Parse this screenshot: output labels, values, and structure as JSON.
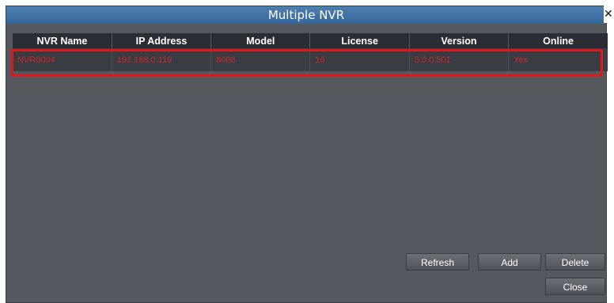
{
  "window": {
    "title": "Multiple NVR",
    "close_glyph": "✕"
  },
  "table": {
    "headers": [
      "NVR Name",
      "IP Address",
      "Model",
      "License",
      "Version",
      "Online"
    ],
    "rows": [
      [
        "NVR0004",
        "192.168.0.119",
        "8008",
        "16",
        "5.0.0.501",
        "Yes"
      ]
    ]
  },
  "buttons": {
    "refresh": "Refresh",
    "add": "Add",
    "delete": "Delete",
    "close": "Close"
  },
  "colors": {
    "title_bar": "#3a6ea5",
    "row_text": "#d02828",
    "highlight_box": "#e01818"
  },
  "icons": {
    "close": "close-icon"
  }
}
